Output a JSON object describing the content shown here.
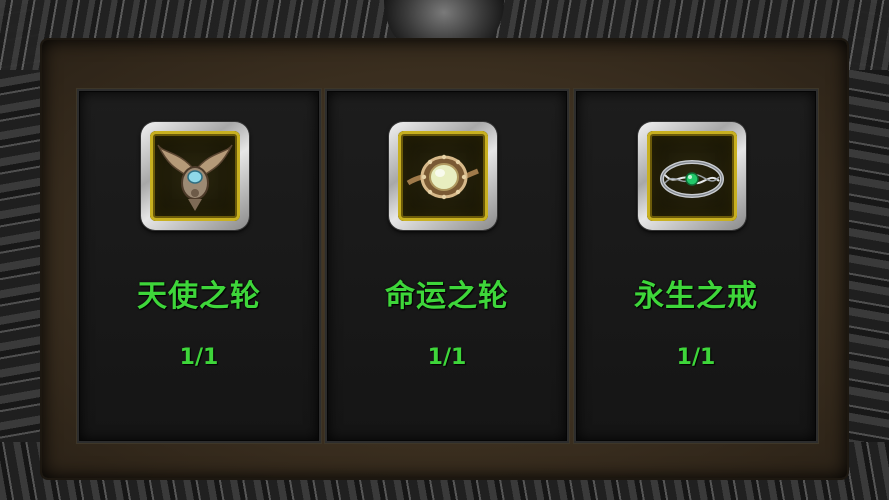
{
  "colors": {
    "name_text": "#3ed63a",
    "count_text": "#3ed63a",
    "slot_gold": "#c8b020"
  },
  "items": [
    {
      "name": "天使之轮",
      "count": "1/1",
      "icon": "winged-angel-amulet-icon"
    },
    {
      "name": "命运之轮",
      "count": "1/1",
      "icon": "opal-ring-icon"
    },
    {
      "name": "永生之戒",
      "count": "1/1",
      "icon": "emerald-silver-ring-icon"
    }
  ]
}
